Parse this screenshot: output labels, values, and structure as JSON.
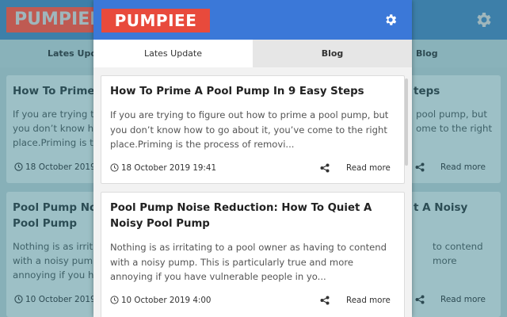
{
  "app": {
    "logo": "PUMPIEE",
    "settings_icon": "gear-icon"
  },
  "tabs": [
    {
      "label": "Lates Update",
      "active": true
    },
    {
      "label": "Blog",
      "active": false
    }
  ],
  "posts": [
    {
      "title": "How To Prime A Pool Pump In 9 Easy Steps",
      "excerpt": [
        "If you are trying to figure out how to prime a pool pump, but",
        "you don’t know how to go about it, you’ve come to the right",
        "place.Priming is the process of removi..."
      ],
      "date": "18 October 2019 19:41",
      "read_more": "Read more"
    },
    {
      "title": "Pool Pump Noise Reduction: How To Quiet A Noisy Pool Pump",
      "excerpt": [
        "Nothing is as irritating to a pool owner as having to contend",
        "with a noisy pump. This is particularly true and more",
        "annoying if you have vulnerable people in yo..."
      ],
      "date": "10 October 2019 4:00",
      "read_more": "Read more"
    }
  ],
  "background": {
    "logo": "PUMPIEE",
    "tab_left": "Lates Upda",
    "tab_right": "Blog",
    "card1": {
      "title_left": "How To Prime A",
      "title_right": "teps",
      "text_left": [
        "If you are trying t",
        "you don’t know h",
        "place.Priming is t"
      ],
      "text_right": [
        "pool pump, but",
        "ome to the right",
        ""
      ],
      "date": "18 October 2019",
      "read": "Read more"
    },
    "card2": {
      "title_left": [
        "Pool Pump Nois",
        "Pool Pump"
      ],
      "title_right": "t A Noisy",
      "text_left": [
        "Nothing is as irrit",
        "with a noisy pum",
        "annoying if you h"
      ],
      "text_right": [
        "to contend",
        "more",
        ""
      ],
      "date": "10 October 2019",
      "read": "Read more"
    }
  },
  "colors": {
    "header": "#3b78d8",
    "logo_bg": "#e84a3c",
    "tab_inactive": "#e6e6e6"
  }
}
